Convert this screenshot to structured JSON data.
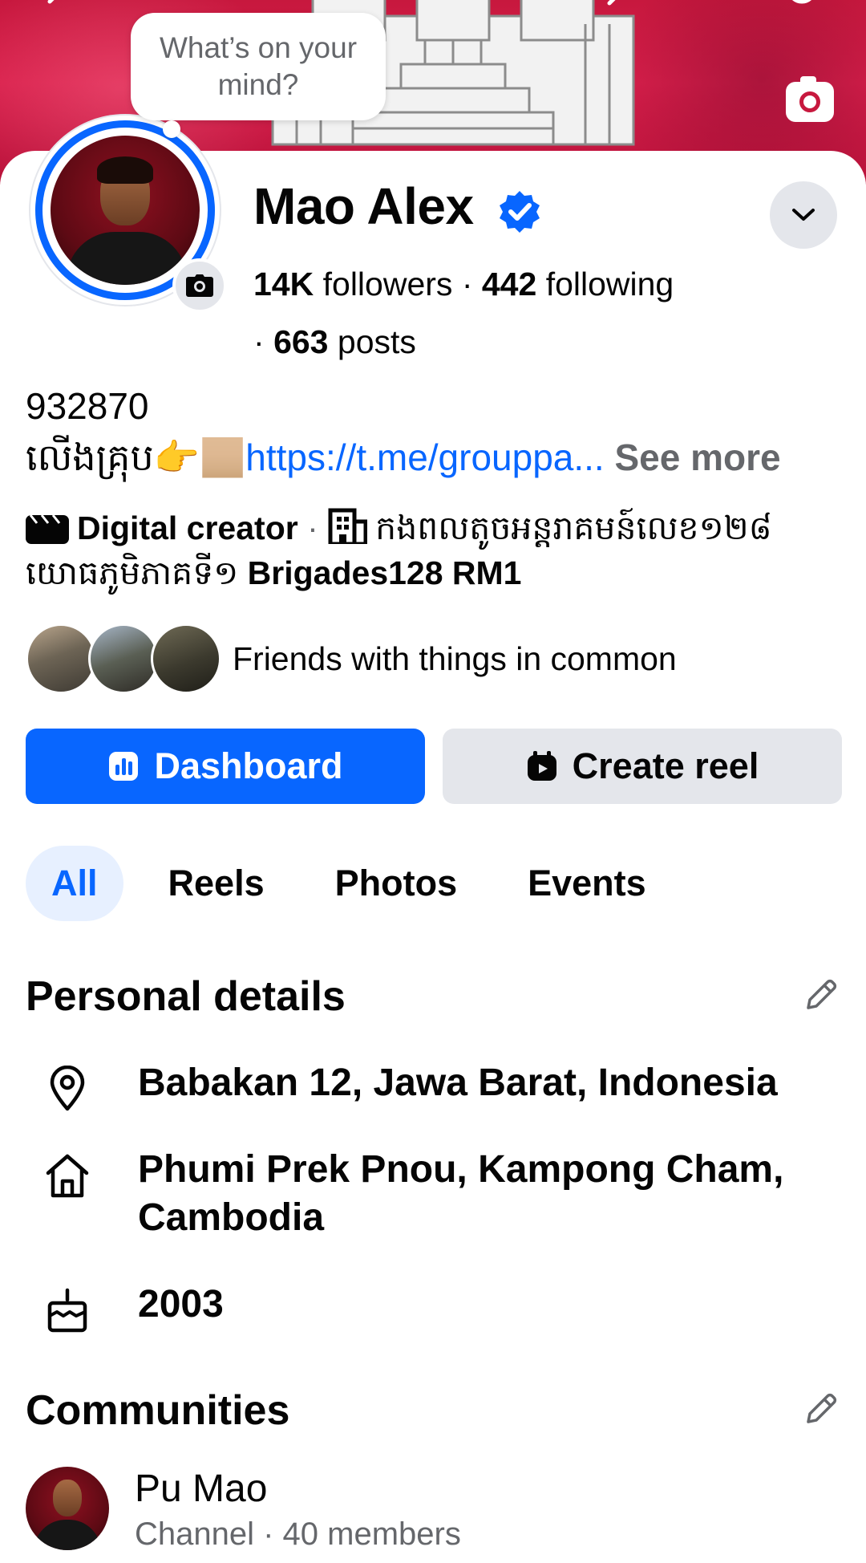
{
  "cover": {
    "camera_icon": "camera-icon"
  },
  "composer": {
    "prompt": "What’s on your mind?"
  },
  "profile": {
    "name": "Mao Alex",
    "verified_icon": "verified-badge-icon",
    "stats": {
      "followers_count": "14K",
      "followers_label": "followers",
      "separator": "·",
      "following_count": "442",
      "following_label": "following",
      "posts_count": "663",
      "posts_label": "posts"
    },
    "bio": {
      "line1": "932870",
      "line2_prefix": "លើងគ្រុប👉🏼",
      "link": "https://t.me/grouppa...",
      "see_more": "See more"
    },
    "work": {
      "category": "Digital creator",
      "dot": "·",
      "workplace_kh": "កងពលតូចអន្តរាគមន៍លេខ១២៨ យោធភូមិភាគទី១",
      "workplace_en": "Brigades128 RM1"
    },
    "friends_text": "Friends with things in common"
  },
  "actions": {
    "primary": "Dashboard",
    "secondary": "Create reel"
  },
  "tabs": [
    {
      "label": "All",
      "active": true
    },
    {
      "label": "Reels",
      "active": false
    },
    {
      "label": "Photos",
      "active": false
    },
    {
      "label": "Events",
      "active": false
    }
  ],
  "personal_details": {
    "title": "Personal details",
    "items": [
      {
        "icon": "location-pin-icon",
        "text": "Babakan 12, Jawa Barat, Indonesia"
      },
      {
        "icon": "home-icon",
        "text": "Phumi Prek Pnou, Kampong Cham, Cambodia"
      },
      {
        "icon": "birthday-cake-icon",
        "text": "2003"
      }
    ]
  },
  "communities": {
    "title": "Communities",
    "items": [
      {
        "name": "Pu Mao",
        "meta": "Channel · 40 members"
      }
    ]
  },
  "colors": {
    "brand_blue": "#0866ff",
    "cover_red": "#c7183e",
    "muted": "#65676b",
    "chip_gray": "#e4e6eb"
  }
}
